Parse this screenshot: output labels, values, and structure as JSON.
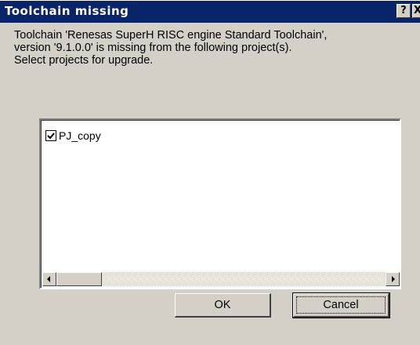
{
  "window": {
    "title": "Toolchain missing",
    "help_label": "?",
    "close_label": "X"
  },
  "message": {
    "line1": "Toolchain 'Renesas SuperH RISC engine Standard Toolchain',",
    "line2": "version '9.1.0.0' is missing from the following project(s).",
    "line3": "Select projects for upgrade."
  },
  "projects": {
    "items": [
      {
        "label": "PJ_copy",
        "checked": true
      }
    ]
  },
  "buttons": {
    "ok_label": "OK",
    "cancel_label": "Cancel"
  },
  "colors": {
    "titlebar": "#0a246a",
    "dialog_bg": "#d4d0c8"
  }
}
